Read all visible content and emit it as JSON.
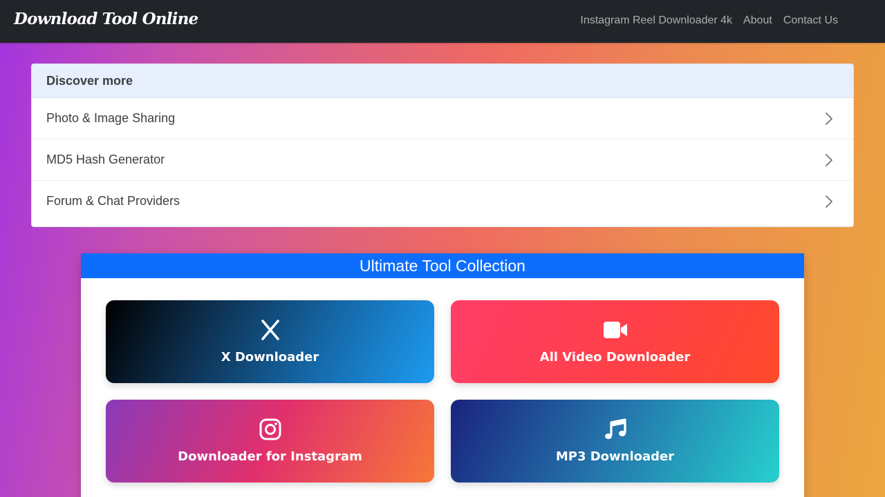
{
  "navbar": {
    "brand": "Download Tool Online",
    "links": [
      {
        "label": "Instagram Reel Downloader 4k"
      },
      {
        "label": "About"
      },
      {
        "label": "Contact Us"
      }
    ]
  },
  "discover": {
    "title": "Discover more",
    "items": [
      {
        "label": "Photo & Image Sharing",
        "icon": "chevron-right-icon"
      },
      {
        "label": "MD5 Hash Generator",
        "icon": "chevron-right-icon"
      },
      {
        "label": "Forum & Chat Providers",
        "icon": "chevron-right-icon"
      }
    ]
  },
  "collection": {
    "title": "Ultimate Tool Collection",
    "tools": [
      {
        "label": "X Downloader",
        "icon": "x-logo-icon"
      },
      {
        "label": "All Video Downloader",
        "icon": "video-camera-icon"
      },
      {
        "label": "Downloader for Instagram",
        "icon": "instagram-icon"
      },
      {
        "label": "MP3 Downloader",
        "icon": "music-note-icon"
      }
    ]
  },
  "colors": {
    "navbar_bg": "#212529",
    "collection_header": "#0d6efd",
    "discover_header_bg": "#e8effc"
  }
}
